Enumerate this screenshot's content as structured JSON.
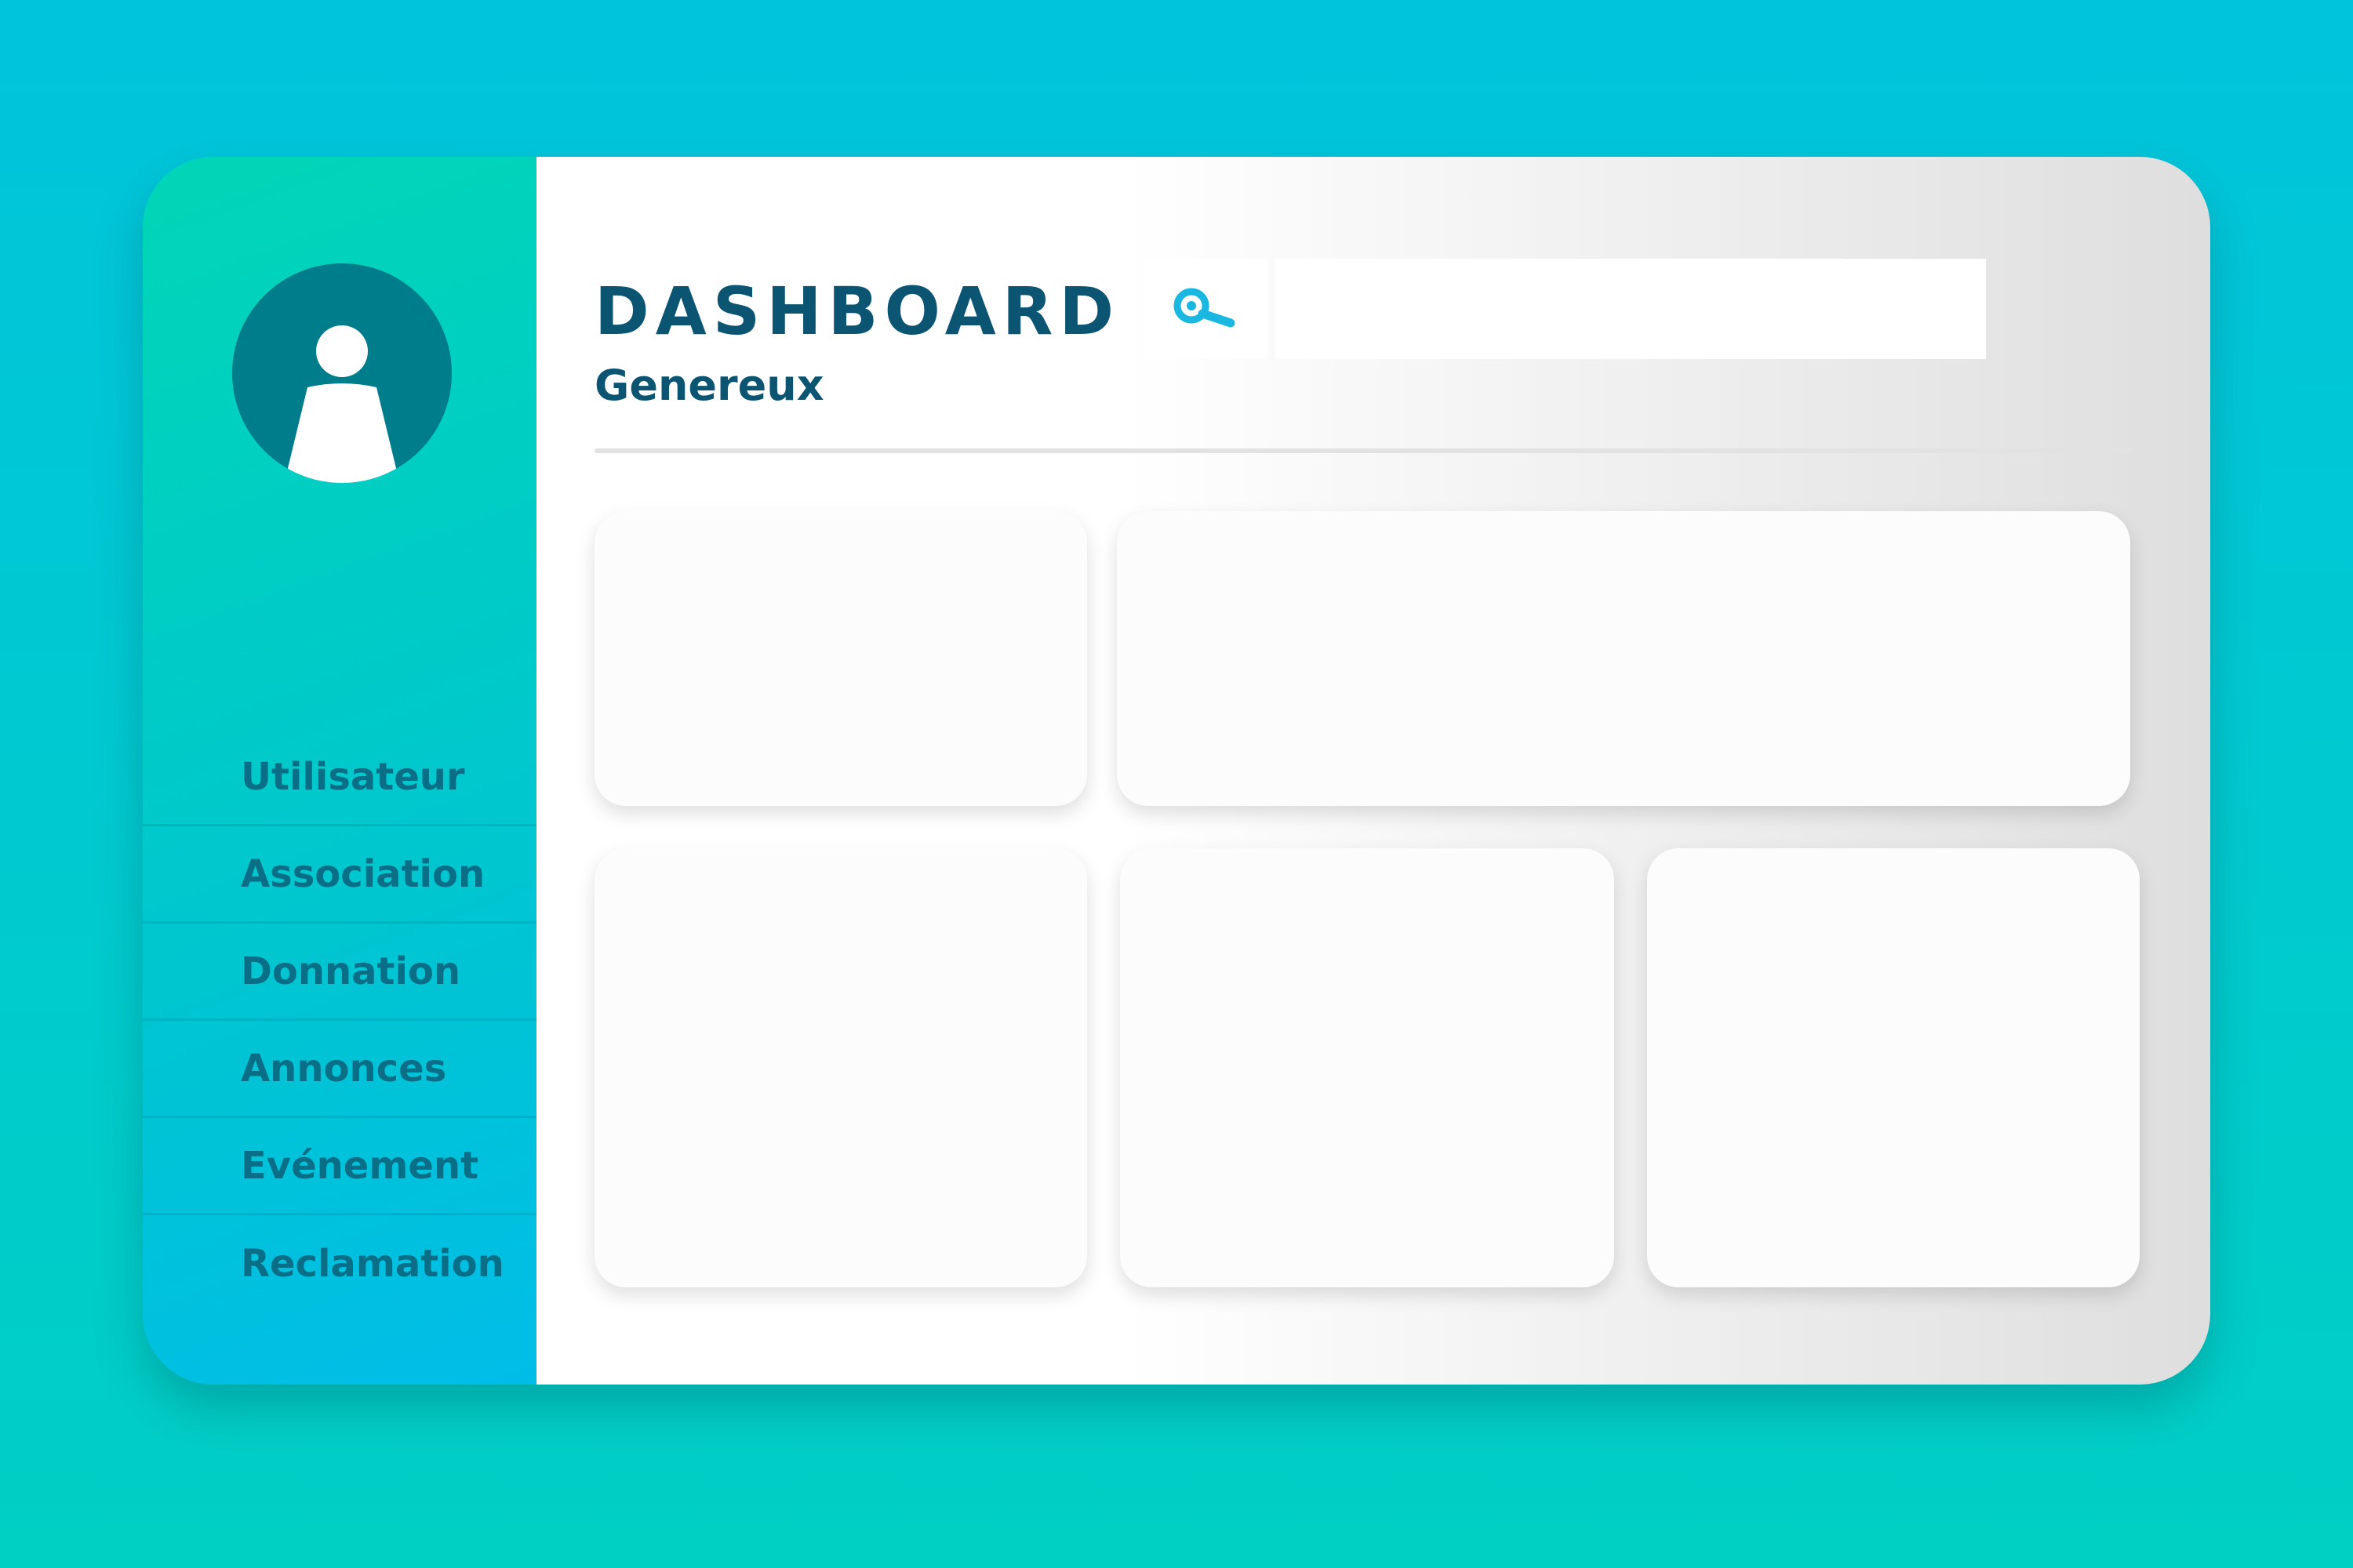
{
  "header": {
    "title": "DASHBOARD",
    "subtitle": "Genereux"
  },
  "search": {
    "placeholder": "",
    "value": "",
    "icon": "search-icon"
  },
  "sidebar": {
    "avatar_icon": "user-icon",
    "items": [
      {
        "label": "Utilisateur"
      },
      {
        "label": "Association"
      },
      {
        "label": "Donnation"
      },
      {
        "label": "Annonces"
      },
      {
        "label": "Evénement"
      },
      {
        "label": "Reclamation"
      }
    ]
  },
  "colors": {
    "background": "#00c8d6",
    "sidebar": "#00cfc4",
    "accent_text": "#0b5573",
    "nav_text": "#0a6e86",
    "avatar": "#007d8a",
    "search_icon": "#1ab8e0"
  }
}
